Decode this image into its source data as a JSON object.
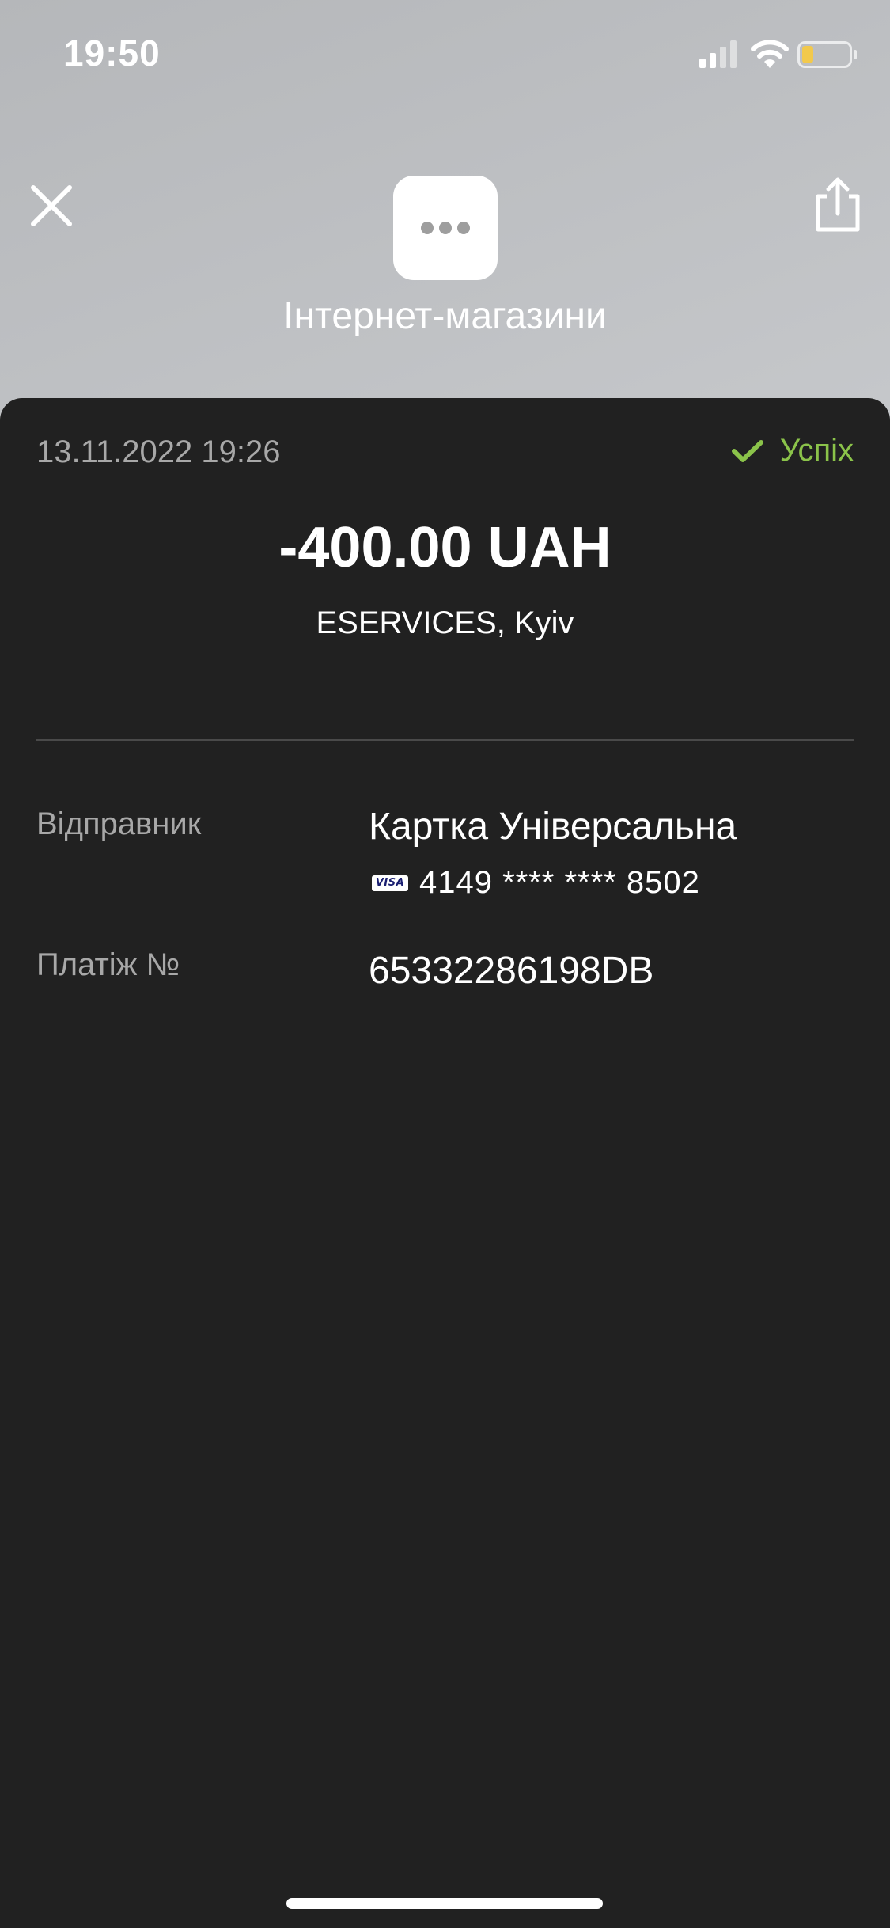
{
  "status_bar": {
    "time": "19:50",
    "battery_color": "#f2c94c"
  },
  "header": {
    "category_icon": "more-dots-icon",
    "category_title": "Інтернет-магазини",
    "close_icon": "close-icon",
    "share_icon": "share-icon"
  },
  "transaction": {
    "date": "13.11.2022 19:26",
    "status": "Успіх",
    "status_color": "#8bc34a",
    "amount": "-400.00 UAH",
    "merchant": "ESERVICES, Kyiv"
  },
  "details": {
    "sender_label": "Відправник",
    "sender_card_name": "Картка Універсальна",
    "card_brand": "VISA",
    "card_number": "4149 **** **** 8502",
    "payment_label": "Платіж №",
    "payment_number": "65332286198DB"
  }
}
